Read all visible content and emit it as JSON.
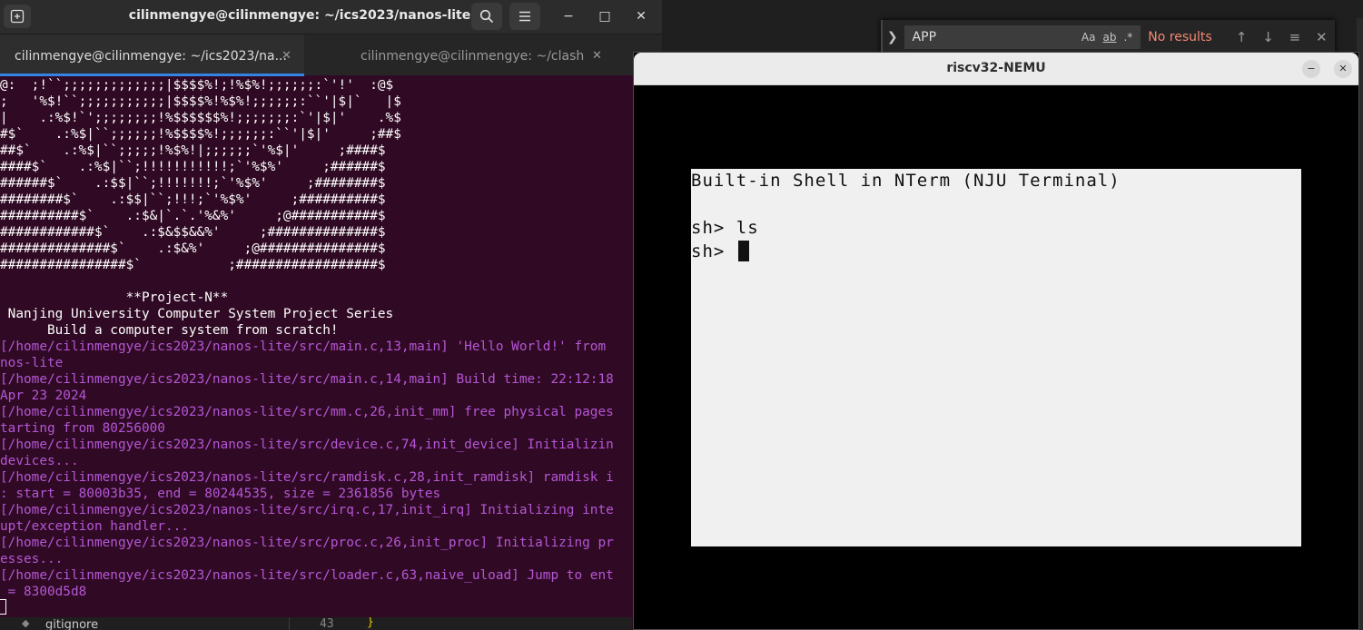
{
  "editor": {
    "find": {
      "query": "APP",
      "opt_case": "Aa",
      "opt_word": "ab",
      "opt_regex": ".*",
      "status": "No results",
      "toggle_icon": "chevron-right-icon"
    }
  },
  "terminal": {
    "title": "cilinmengye@cilinmengye: ~/ics2023/nanos-lite",
    "tabs": [
      {
        "label": "cilinmengye@cilinmengye: ~/ics2023/na...",
        "active": true
      },
      {
        "label": "cilinmengye@cilinmengye: ~/clash",
        "active": false
      }
    ],
    "lines": [
      {
        "text": "@:  ;!``;;;;;;;;;;;;;|$$$$%!;!%$%!;;;;;;:`'!'  :@$",
        "color": "white"
      },
      {
        "text": ";   '%$!``;;;;;;;;;;;|$$$$%!%$%!;;;;;;:``'|$|`   |$",
        "color": "white"
      },
      {
        "text": "|    .:%$!`';;;;;;;;!%$$$$$$%!;;;;;;;:`'|$|'    .%$",
        "color": "white"
      },
      {
        "text": "#$`    .:%$|``;;;;;;!%$$$$%!;;;;;;:``'|$|'     ;##$",
        "color": "white"
      },
      {
        "text": "##$`    .:%$|``;;;;;!%$%!|;;;;;;`'%$|'     ;####$",
        "color": "white"
      },
      {
        "text": "####$`    .:%$|``;!!!!!!!!!!!;`'%$%'     ;######$",
        "color": "white"
      },
      {
        "text": "######$`    .:$$|``;!!!!!!!;`'%$%'     ;########$",
        "color": "white"
      },
      {
        "text": "########$`    .:$$|``;!!!;`'%$%'     ;##########$",
        "color": "white"
      },
      {
        "text": "##########$`    .:$&|`.`.'%&%'     ;@###########$",
        "color": "white"
      },
      {
        "text": "############$`    .:$&$$&&%'     ;##############$",
        "color": "white"
      },
      {
        "text": "##############$`    .:$&%'     ;@###############$",
        "color": "white"
      },
      {
        "text": "################$`           ;##################$",
        "color": "white"
      },
      {
        "text": "",
        "color": "white"
      },
      {
        "text": "                **Project-N**",
        "color": "white"
      },
      {
        "text": " Nanjing University Computer System Project Series",
        "color": "white"
      },
      {
        "text": "      Build a computer system from scratch!",
        "color": "white"
      },
      {
        "text": "[/home/cilinmengye/ics2023/nanos-lite/src/main.c,13,main] 'Hello World!' from",
        "color": "magenta"
      },
      {
        "text": "nos-lite",
        "color": "magenta"
      },
      {
        "text": "[/home/cilinmengye/ics2023/nanos-lite/src/main.c,14,main] Build time: 22:12:18",
        "color": "magenta"
      },
      {
        "text": "Apr 23 2024",
        "color": "magenta"
      },
      {
        "text": "[/home/cilinmengye/ics2023/nanos-lite/src/mm.c,26,init_mm] free physical pages",
        "color": "magenta"
      },
      {
        "text": "tarting from 80256000",
        "color": "magenta"
      },
      {
        "text": "[/home/cilinmengye/ics2023/nanos-lite/src/device.c,74,init_device] Initializin",
        "color": "magenta"
      },
      {
        "text": "devices...",
        "color": "magenta"
      },
      {
        "text": "[/home/cilinmengye/ics2023/nanos-lite/src/ramdisk.c,28,init_ramdisk] ramdisk i",
        "color": "magenta"
      },
      {
        "text": ": start = 80003b35, end = 80244535, size = 2361856 bytes",
        "color": "magenta"
      },
      {
        "text": "[/home/cilinmengye/ics2023/nanos-lite/src/irq.c,17,init_irq] Initializing inte",
        "color": "magenta"
      },
      {
        "text": "upt/exception handler...",
        "color": "magenta"
      },
      {
        "text": "[/home/cilinmengye/ics2023/nanos-lite/src/proc.c,26,init_proc] Initializing pr",
        "color": "magenta"
      },
      {
        "text": "esses...",
        "color": "magenta"
      },
      {
        "text": "[/home/cilinmengye/ics2023/nanos-lite/src/loader.c,63,naive_uload] Jump to ent",
        "color": "magenta"
      },
      {
        "text": " = 8300d5d8",
        "color": "magenta"
      }
    ]
  },
  "explorer_strip": {
    "file": "gitignore",
    "line_number": "43",
    "code": "}"
  },
  "nemu": {
    "title": "riscv32-NEMU",
    "screen_lines": [
      "Built-in Shell in NTerm (NJU Terminal)",
      "",
      "sh> ls",
      "sh> "
    ]
  },
  "colors": {
    "terminal_bg": "#300a24",
    "magenta_text": "#b556d6",
    "tab_accent": "#3584e4",
    "find_no_results": "#f48771"
  }
}
